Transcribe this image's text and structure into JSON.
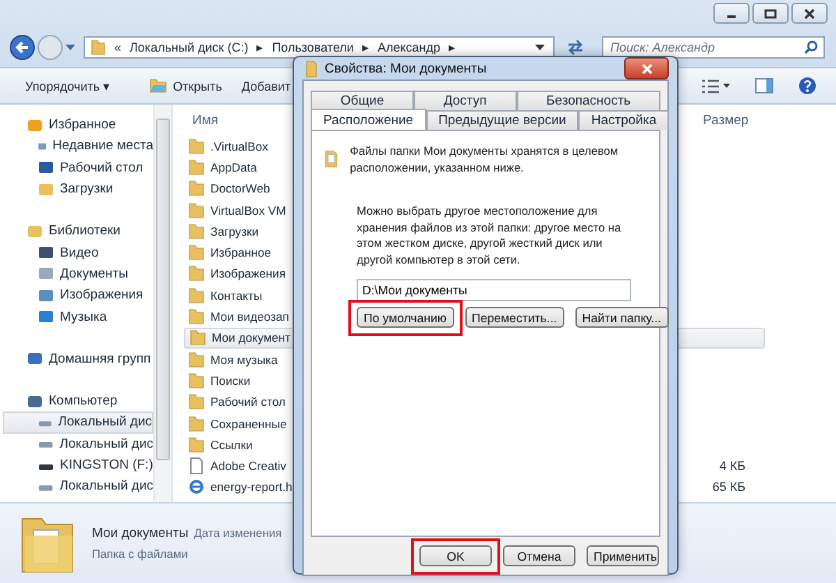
{
  "address": {
    "crumbs": [
      "«",
      "Локальный диск (C:)",
      "▸",
      "Пользователи",
      "▸",
      "Александр",
      "▸"
    ]
  },
  "search": {
    "placeholder": "Поиск: Александр"
  },
  "toolbar": {
    "items": [
      {
        "label": "Упорядочить ▾",
        "kind": "menu"
      },
      {
        "label": "Открыть",
        "kind": "open"
      },
      {
        "label": "Добавит",
        "kind": "plain"
      }
    ]
  },
  "nav": [
    {
      "label": "Избранное",
      "kind": "star",
      "selected": false,
      "children": [
        {
          "label": "Недавние места",
          "kind": "recent",
          "selected": false
        },
        {
          "label": "Рабочий стол",
          "kind": "desktop",
          "selected": false
        },
        {
          "label": "Загрузки",
          "kind": "download",
          "selected": false
        }
      ]
    },
    {
      "label": "Библиотеки",
      "kind": "library",
      "selected": false,
      "children": [
        {
          "label": "Видео",
          "kind": "video",
          "selected": false
        },
        {
          "label": "Документы",
          "kind": "document",
          "selected": false
        },
        {
          "label": "Изображения",
          "kind": "image",
          "selected": false
        },
        {
          "label": "Музыка",
          "kind": "music",
          "selected": false
        }
      ]
    },
    {
      "label": "Домашняя групп",
      "kind": "homegroup",
      "selected": false
    },
    {
      "label": "Компьютер",
      "kind": "computer",
      "selected": false,
      "children": [
        {
          "label": "Локальный дис",
          "kind": "drive",
          "selected": true
        },
        {
          "label": "Локальный дис",
          "kind": "drive",
          "selected": false
        },
        {
          "label": "KINGSTON (F:)",
          "kind": "usb",
          "selected": false
        },
        {
          "label": "Локальный дис",
          "kind": "drive",
          "selected": false
        }
      ]
    }
  ],
  "table": {
    "columns": [
      "Имя",
      "Размер"
    ],
    "rows": [
      {
        "name": ".VirtualBox",
        "kind": "folder",
        "selected": false
      },
      {
        "name": "AppData",
        "kind": "folder",
        "selected": false
      },
      {
        "name": "DoctorWeb",
        "kind": "folder",
        "selected": false
      },
      {
        "name": "VirtualBox VM",
        "kind": "folder",
        "selected": false
      },
      {
        "name": "Загрузки",
        "kind": "folder",
        "selected": false
      },
      {
        "name": "Избранное",
        "kind": "folder",
        "selected": false
      },
      {
        "name": "Изображения",
        "kind": "folder",
        "selected": false
      },
      {
        "name": "Контакты",
        "kind": "folder",
        "selected": false
      },
      {
        "name": "Мои видеозап",
        "kind": "folder",
        "selected": false
      },
      {
        "name": "Мои документ",
        "kind": "folder",
        "selected": true
      },
      {
        "name": "Моя музыка",
        "kind": "folder",
        "selected": false
      },
      {
        "name": "Поиски",
        "kind": "folder",
        "selected": false
      },
      {
        "name": "Рабочий стол",
        "kind": "folder",
        "selected": false
      },
      {
        "name": "Сохраненные",
        "kind": "folder",
        "selected": false
      },
      {
        "name": "Ссылки",
        "kind": "folder",
        "selected": false
      },
      {
        "name": "Adobe Creativ",
        "kind": "file",
        "selected": false,
        "size": "4 КБ"
      },
      {
        "name": "energy-report.h",
        "kind": "web",
        "selected": false,
        "size": "65 КБ"
      }
    ]
  },
  "details": {
    "name": "Мои документы",
    "type": "Папка с файлами",
    "date_label": "Дата изменения"
  },
  "dialog": {
    "title": "Свойства: Мои документы",
    "tab_rows": [
      [
        {
          "label": "Общие",
          "selected": false
        },
        {
          "label": "Доступ",
          "selected": false
        },
        {
          "label": "Безопасность",
          "selected": false
        }
      ],
      [
        {
          "label": "Расположение",
          "selected": true
        },
        {
          "label": "Предыдущие версии",
          "selected": false
        },
        {
          "label": "Настройка",
          "selected": false
        }
      ]
    ],
    "info": "Файлы папки Мои документы хранятся в целевом расположении, указанном ниже.",
    "description": "Можно выбрать другое местоположение для хранения файлов из этой папки: другое место на этом жестком диске, другой жесткий диск или другой компьютер в этой сети.",
    "path": "D:\\Мои документы",
    "path_buttons": [
      {
        "label": "По умолчанию",
        "highlighted": true
      },
      {
        "label": "Переместить...",
        "highlighted": false
      },
      {
        "label": "Найти папку...",
        "highlighted": false
      }
    ],
    "buttons": [
      {
        "label": "OK",
        "highlighted": true
      },
      {
        "label": "Отмена",
        "highlighted": false
      },
      {
        "label": "Применить",
        "highlighted": false
      }
    ]
  }
}
